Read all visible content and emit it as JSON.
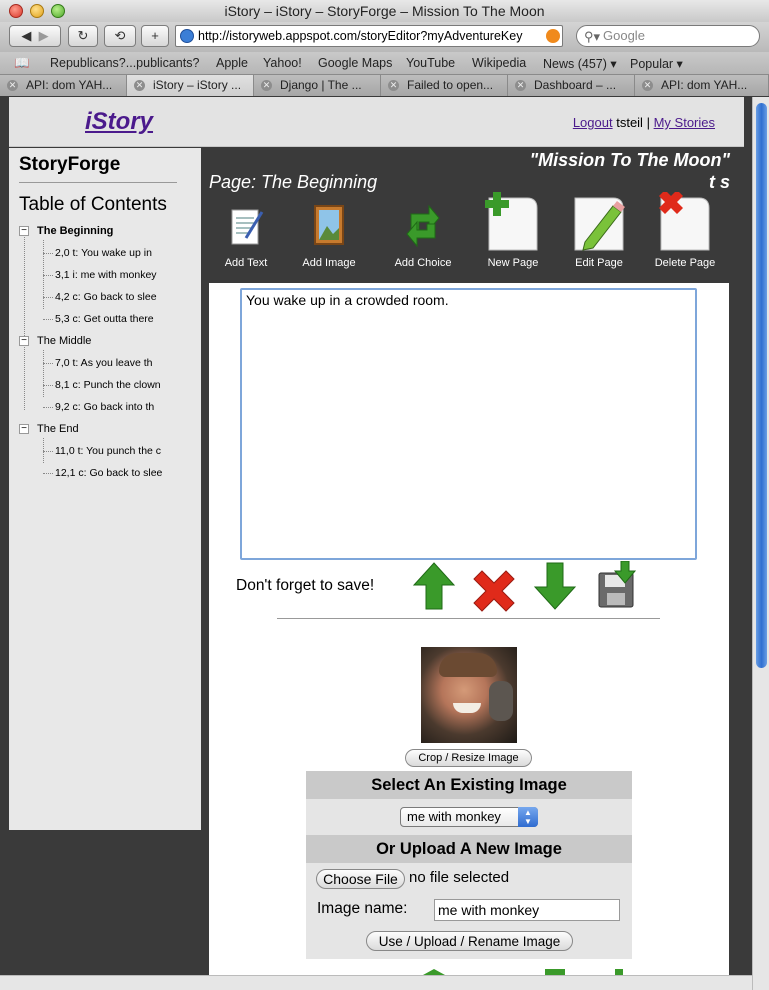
{
  "browser": {
    "window_title": "iStory – iStory – StoryForge – Mission To The Moon",
    "url": "http://istoryweb.appspot.com/storyEditor?myAdventureKey",
    "search_placeholder": "Google",
    "bookmarks": [
      "Republicans?...publicants?",
      "Apple",
      "Yahoo!",
      "Google Maps",
      "YouTube",
      "Wikipedia",
      "News (457) ▾",
      "Popular ▾"
    ],
    "tabs": [
      "API: dom YAH...",
      "iStory – iStory ...",
      "Django | The ...",
      "Failed to open...",
      "Dashboard – ...",
      "API: dom YAH..."
    ]
  },
  "header": {
    "logo": "iStory",
    "logout": "Logout",
    "username": "tsteil",
    "separator": "|",
    "my_stories": "My Stories"
  },
  "sidebar": {
    "title": "StoryForge",
    "toc_title": "Table of Contents",
    "sections": [
      {
        "label": "The Beginning",
        "items": [
          "2,0 t:  You wake up in",
          "3,1 i:  me with monkey",
          "4,2 c:  Go back to slee",
          "5,3 c:  Get outta there"
        ]
      },
      {
        "label": "The Middle",
        "items": [
          "7,0 t:  As you leave th",
          "8,1 c:  Punch the clown",
          "9,2 c:  Go back into th"
        ]
      },
      {
        "label": "The End",
        "items": [
          "11,0 t:  You punch the c",
          "12,1 c:  Go back to slee"
        ]
      }
    ]
  },
  "story": {
    "title_line1": "\"Mission To The Moon\"",
    "title_line2": "t s",
    "page_title": "Page: The Beginning"
  },
  "tools": {
    "add_text": "Add Text",
    "add_image": "Add Image",
    "add_choice": "Add Choice",
    "new_page": "New Page",
    "edit_page": "Edit Page",
    "delete_page": "Delete Page"
  },
  "editor": {
    "text": "You wake up in a crowded room.",
    "save_note": "Don't forget to save!"
  },
  "image": {
    "crop_button": "Crop / Resize Image",
    "select_heading": "Select An Existing Image",
    "selected_option": "me with monkey",
    "upload_heading": "Or Upload A New Image",
    "choose_file": "Choose File",
    "file_status": "no file selected",
    "name_label": "Image name:",
    "name_value": "me with monkey",
    "use_button": "Use / Upload / Rename Image"
  },
  "colors": {
    "brand": "#4b1a8c",
    "panel_dark": "#3a3a3a",
    "arrow_green": "#3a9a2a",
    "delete_red": "#e02a1a"
  }
}
